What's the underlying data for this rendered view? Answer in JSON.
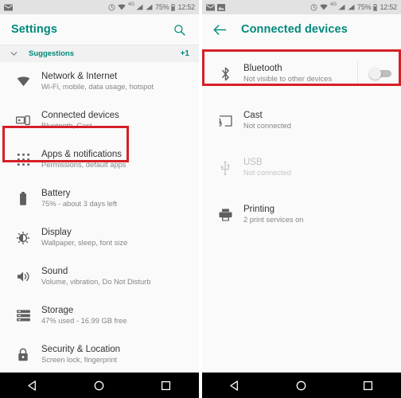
{
  "status_bar": {
    "notification_icons": [
      "mail-icon",
      "image-icon"
    ],
    "left_icons_left_screen": [
      "mail-icon"
    ],
    "sync_icon": "sync-circle-icon",
    "wifi_icon": "wifi-icon",
    "network_type": "4G",
    "signal_icons": [
      "signal-bars-icon",
      "signal-bars-icon"
    ],
    "battery_percent": "75%",
    "battery_icon": "battery-icon",
    "clock": "12:52"
  },
  "left_screen": {
    "appbar": {
      "title": "Settings",
      "search_icon": "search-icon"
    },
    "suggestions": {
      "expand_icon": "chevron-down-icon",
      "label": "Suggestions",
      "count": "+1"
    },
    "items": [
      {
        "icon": "wifi-icon",
        "title": "Network & Internet",
        "subtitle": "Wi-Fi, mobile, data usage, hotspot",
        "disabled": false
      },
      {
        "icon": "connected-devices-icon",
        "title": "Connected devices",
        "subtitle": "Bluetooth, Cast",
        "disabled": false,
        "highlighted": true
      },
      {
        "icon": "apps-grid-icon",
        "title": "Apps & notifications",
        "subtitle": "Permissions, default apps",
        "disabled": false
      },
      {
        "icon": "battery-icon",
        "title": "Battery",
        "subtitle": "75% - about 3 days left",
        "disabled": false
      },
      {
        "icon": "brightness-icon",
        "title": "Display",
        "subtitle": "Wallpaper, sleep, font size",
        "disabled": false
      },
      {
        "icon": "sound-icon",
        "title": "Sound",
        "subtitle": "Volume, vibration, Do Not Disturb",
        "disabled": false
      },
      {
        "icon": "storage-icon",
        "title": "Storage",
        "subtitle": "47% used - 16.99 GB free",
        "disabled": false
      },
      {
        "icon": "lock-icon",
        "title": "Security & Location",
        "subtitle": "Screen lock, fingerprint",
        "disabled": false
      }
    ]
  },
  "right_screen": {
    "appbar": {
      "back_icon": "arrow-back-icon",
      "title": "Connected devices"
    },
    "items": [
      {
        "icon": "bluetooth-icon",
        "title": "Bluetooth",
        "subtitle": "Not visible to other devices",
        "disabled": false,
        "highlighted": true,
        "toggle": "off"
      },
      {
        "icon": "cast-icon",
        "title": "Cast",
        "subtitle": "Not connected",
        "disabled": false
      },
      {
        "icon": "usb-icon",
        "title": "USB",
        "subtitle": "Not connected",
        "disabled": true
      },
      {
        "icon": "printer-icon",
        "title": "Printing",
        "subtitle": "2 print services on",
        "disabled": false
      }
    ]
  },
  "navbar": {
    "back_icon": "nav-back-triangle-icon",
    "home_icon": "nav-home-circle-icon",
    "recents_icon": "nav-recents-square-icon"
  },
  "colors": {
    "accent_teal": "#00897b",
    "highlight_red": "#d61f26",
    "background": "#fafafa",
    "statusbar": "#e2e2e2",
    "navbar": "#000000",
    "primary_text": "#343434",
    "secondary_text": "#858585",
    "disabled_text": "#bdbdbd"
  }
}
